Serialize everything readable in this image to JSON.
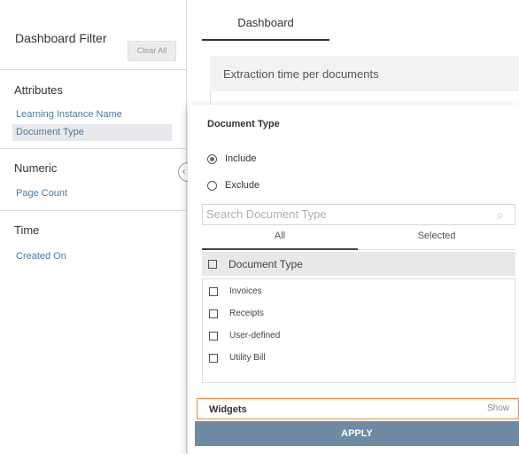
{
  "sidebar": {
    "title": "Dashboard Filter",
    "clear_label": "Clear All",
    "sections": {
      "attributes": {
        "heading": "Attributes",
        "items": [
          "Learning Instance Name",
          "Document Type"
        ]
      },
      "numeric": {
        "heading": "Numeric",
        "items": [
          "Page Count"
        ]
      },
      "time": {
        "heading": "Time",
        "items": [
          "Created On"
        ]
      }
    },
    "collapse_glyph": "‹"
  },
  "tabs": {
    "dashboard": "Dashboard"
  },
  "widget": {
    "title": "Extraction time per documents"
  },
  "filter_panel": {
    "title": "Document Type",
    "include_label": "Include",
    "exclude_label": "Exclude",
    "search_placeholder": "Search Document Type",
    "segments": {
      "all": "All",
      "selected": "Selected"
    },
    "list_header": "Document Type",
    "options": [
      "Invoices",
      "Receipts",
      "User-defined",
      "Utility Bill"
    ],
    "widgets_label": "Widgets",
    "show_label": "Show",
    "apply_label": "APPLY"
  },
  "colors": {
    "accent": "#6f8aa3",
    "highlight": "#f08a3a",
    "link": "#4a7aa4"
  }
}
